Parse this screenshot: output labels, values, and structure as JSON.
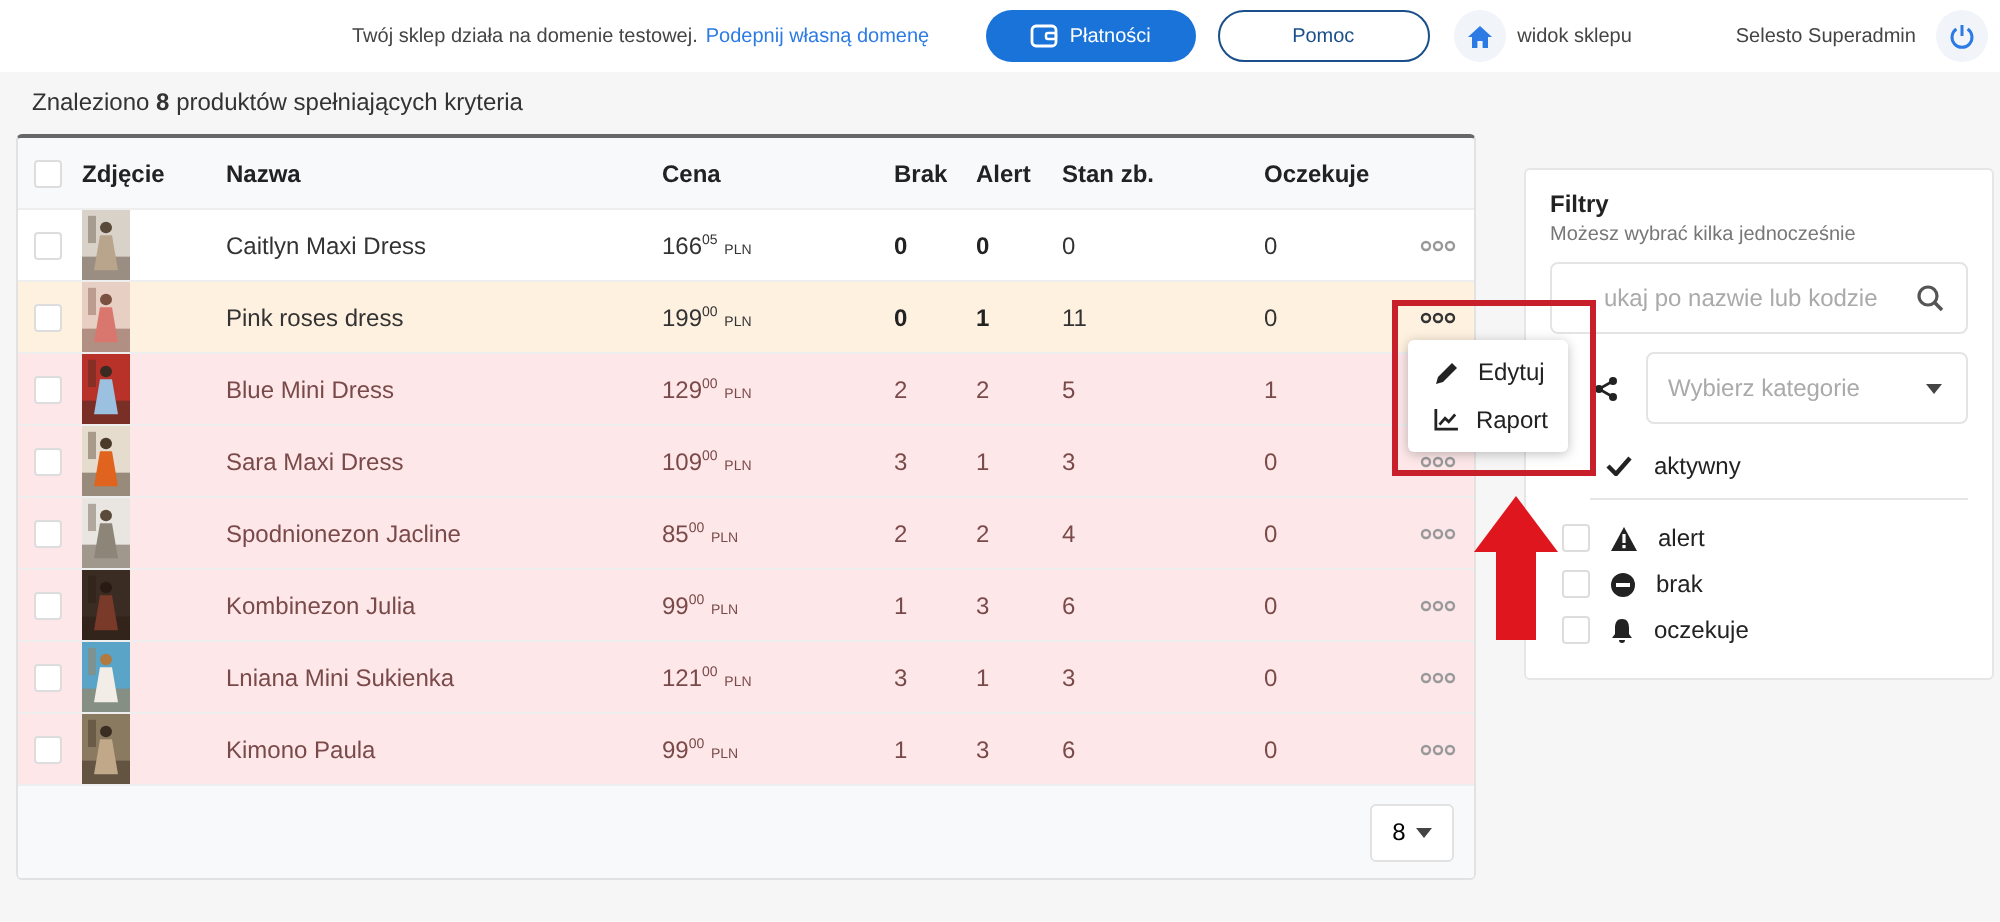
{
  "topbar": {
    "notice": "Twój sklep działa na domenie testowej.",
    "notice_link": "Podepnij własną domenę",
    "buttons": [
      {
        "label": "Płatności",
        "kind": "primary"
      },
      {
        "label": "Pomoc",
        "kind": "outline"
      }
    ],
    "shop_link": "widok sklepu",
    "user": "Selesto Superadmin"
  },
  "results": "Znaleziono **8** produktów spełniających kryteria",
  "table": {
    "columns": [
      "Zdjęcie",
      "Nazwa",
      "Cena",
      "Brak",
      "Alert",
      "Stan zb.",
      "Oczekuje"
    ],
    "rows": [
      {
        "name": "Caitlyn Maxi Dress",
        "price": "166",
        "cents": "05",
        "currency": "PLN",
        "brak": "0",
        "alert": "0",
        "stock": "0",
        "waiting": "0",
        "kind": "ok",
        "checked": false
      },
      {
        "name": "Pink roses dress",
        "price": "199",
        "cents": "00",
        "currency": "PLN",
        "brak": "0",
        "alert": "1",
        "stock": "11",
        "waiting": "0",
        "kind": "alert",
        "checked": false
      },
      {
        "name": "Blue Mini Dress",
        "price": "129",
        "cents": "00",
        "currency": "PLN",
        "brak": "2",
        "alert": "2",
        "stock": "5",
        "waiting": "1",
        "kind": "missing",
        "checked": false
      },
      {
        "name": "Sara Maxi Dress",
        "price": "109",
        "cents": "00",
        "currency": "PLN",
        "brak": "3",
        "alert": "1",
        "stock": "3",
        "waiting": "0",
        "kind": "missing",
        "checked": false
      },
      {
        "name": "Spodnionezon Jacline",
        "price": "85",
        "cents": "00",
        "currency": "PLN",
        "brak": "2",
        "alert": "2",
        "stock": "4",
        "waiting": "0",
        "kind": "missing",
        "checked": false
      },
      {
        "name": "Kombinezon Julia",
        "price": "99",
        "cents": "00",
        "currency": "PLN",
        "brak": "1",
        "alert": "3",
        "stock": "6",
        "waiting": "0",
        "kind": "missing",
        "checked": false
      },
      {
        "name": "Lniana Mini Sukienka",
        "price": "121",
        "cents": "00",
        "currency": "PLN",
        "brak": "3",
        "alert": "1",
        "stock": "3",
        "waiting": "0",
        "kind": "missing",
        "checked": false
      },
      {
        "name": "Kimono Paula",
        "price": "99",
        "cents": "00",
        "currency": "PLN",
        "brak": "1",
        "alert": "3",
        "stock": "6",
        "waiting": "0",
        "kind": "missing",
        "checked": false
      }
    ],
    "page_size": "8",
    "select_all_checked": false
  },
  "row_menu": {
    "items": [
      {
        "label": "Edytuj",
        "kind": "edit"
      },
      {
        "label": "Raport",
        "kind": "report"
      }
    ]
  },
  "filters": {
    "title": "Filtry",
    "subtitle": "Możesz wybrać kilka jednocześnie",
    "search_placeholder": "ukaj po nazwie lub kodzie",
    "category_placeholder": "Wybierz kategorie",
    "active": {
      "label": "aktywny",
      "checked": true
    },
    "options": [
      {
        "label": "alert",
        "kind": "alert",
        "checked": false
      },
      {
        "label": "brak",
        "kind": "missing",
        "checked": false
      },
      {
        "label": "oczekuje",
        "kind": "waiting",
        "checked": false
      }
    ]
  }
}
